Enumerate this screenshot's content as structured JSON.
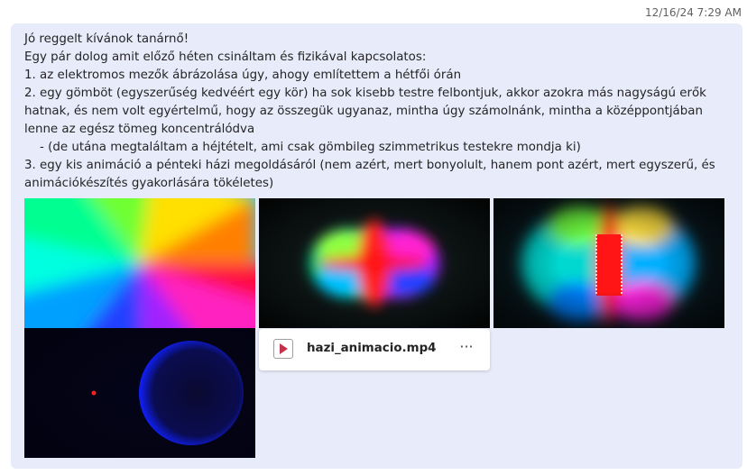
{
  "message": {
    "timestamp": "12/16/24 7:29 AM",
    "lines": [
      "Jó reggelt kívánok tanárnő!",
      "Egy pár dolog amit előző héten csináltam és fizikával kapcsolatos:",
      "1. az elektromos mezők ábrázolása úgy, ahogy említettem a hétfői órán",
      "2. egy gömböt (egyszerűség kedvéért egy kör) ha sok kisebb testre felbontjuk, akkor azokra más nagyságú erők hatnak, és nem volt egyértelmű, hogy az összegük ugyanaz, mintha úgy számolnánk, mintha a középpontjában lenne az egész tömeg koncentrálódva",
      "    - (de utána megtaláltam a héjtételt, ami csak gömbileg szimmetrikus testekre mondja ki)",
      "3. egy kis animáció a pénteki házi megoldásáról (nem azért, mert bonyolult, hanem pont azért, mert egyszerű, és animációkészítés gyakorlására tökéletes)"
    ]
  },
  "attachments": {
    "images": [
      {
        "name": "field-single-charge-image"
      },
      {
        "name": "field-dipole-image"
      },
      {
        "name": "field-capacitor-image"
      },
      {
        "name": "sphere-gravity-image"
      }
    ],
    "file": {
      "name": "hazi_animacio.mp4",
      "icon": "play-icon",
      "more": "···",
      "accent": "#c4314b"
    }
  }
}
